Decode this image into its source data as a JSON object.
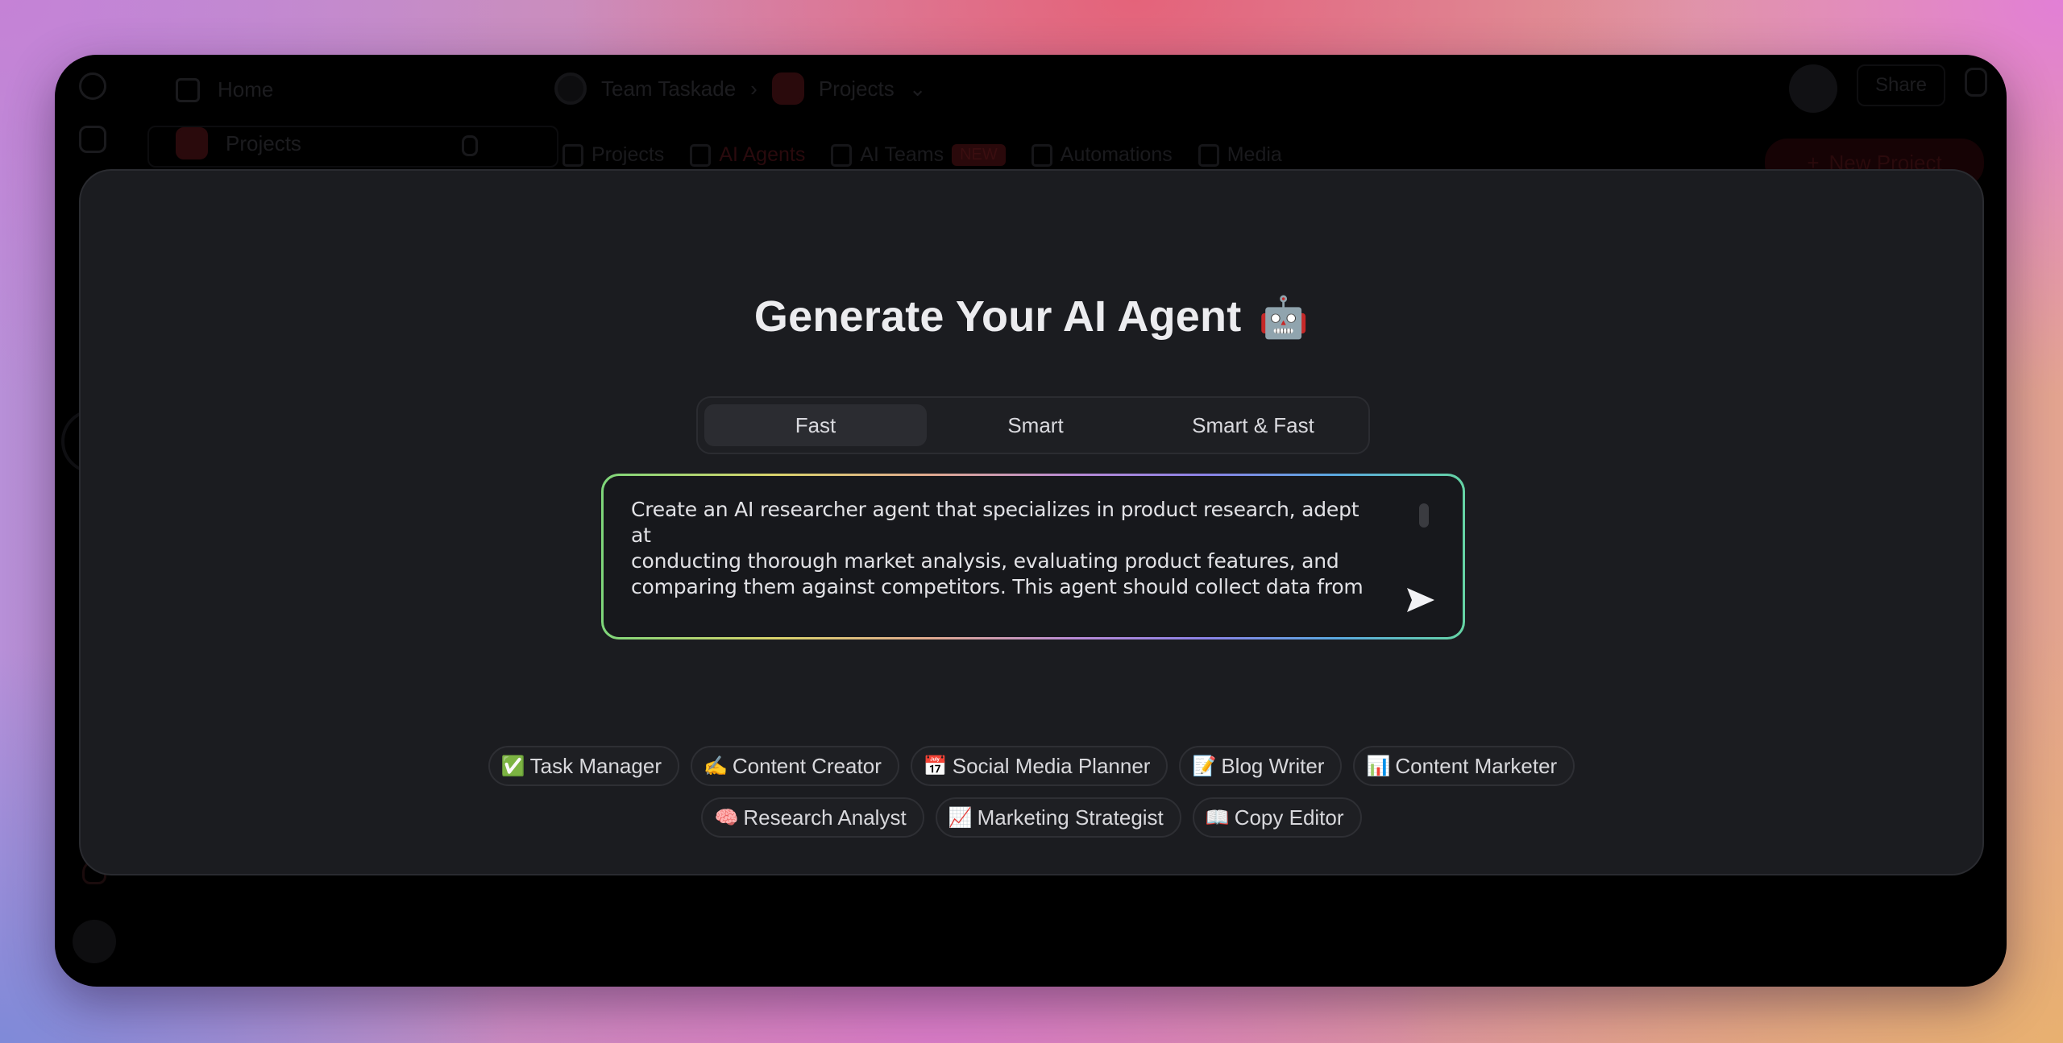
{
  "background_app": {
    "sidebar": {
      "items": [
        {
          "label": "Home",
          "icon": "home-icon"
        },
        {
          "label": "Projects",
          "icon": "projects-icon",
          "locked": true
        }
      ],
      "rail_icons": [
        "search-icon",
        "clock-icon",
        "bell-icon",
        "user-avatar"
      ]
    },
    "breadcrumb": {
      "workspace": "Team Taskade",
      "separator": "›",
      "current": "Projects"
    },
    "tabs": [
      {
        "label": "Projects",
        "icon": "projects-icon"
      },
      {
        "label": "AI Agents",
        "icon": "robot-icon",
        "active": true
      },
      {
        "label": "AI Teams",
        "icon": "team-icon",
        "badge": "NEW"
      },
      {
        "label": "Automations",
        "icon": "automation-icon"
      },
      {
        "label": "Media",
        "icon": "file-icon"
      }
    ],
    "header_right": {
      "share_label": "Share",
      "new_project_label": "New Project",
      "new_project_icon": "+"
    }
  },
  "modal": {
    "title": "Generate Your AI Agent",
    "title_emoji": "🤖",
    "modes": [
      {
        "label": "Fast",
        "active": true
      },
      {
        "label": "Smart",
        "active": false
      },
      {
        "label": "Smart & Fast",
        "active": false
      }
    ],
    "prompt": {
      "value": "Create an AI researcher agent that specializes in product research, adept at\nconducting thorough market analysis, evaluating product features, and\ncomparing them against competitors. This agent should collect data from",
      "send_icon": "send-icon"
    },
    "suggestions_row1": [
      {
        "emoji": "✅",
        "label": "Task Manager"
      },
      {
        "emoji": "✍️",
        "label": "Content Creator"
      },
      {
        "emoji": "📅",
        "label": "Social Media Planner"
      },
      {
        "emoji": "📝",
        "label": "Blog Writer"
      },
      {
        "emoji": "📊",
        "label": "Content Marketer"
      }
    ],
    "suggestions_row2": [
      {
        "emoji": "🧠",
        "label": "Research Analyst"
      },
      {
        "emoji": "📈",
        "label": "Marketing Strategist"
      },
      {
        "emoji": "📖",
        "label": "Copy Editor"
      }
    ]
  },
  "colors": {
    "modal_bg": "#1b1c20",
    "window_bg": "#000000",
    "text": "#ececef",
    "gradient_border": [
      "#7ed67a",
      "#d9d36b",
      "#b88ad6",
      "#5aa8e0",
      "#65d4a4"
    ]
  }
}
